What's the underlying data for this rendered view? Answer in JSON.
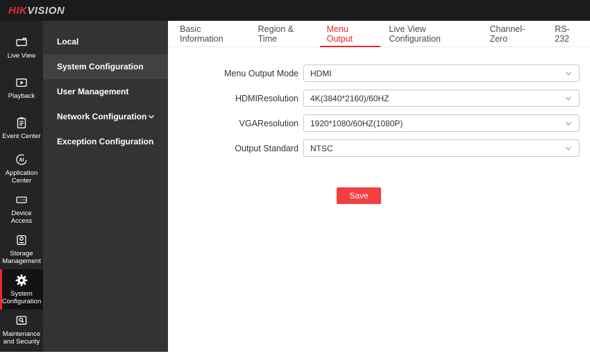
{
  "topbar": {
    "logo_hik": "HIK",
    "logo_vision": "VISION"
  },
  "sidebar": {
    "items": [
      {
        "label": "Live View",
        "icon": "live-view-icon",
        "active": false
      },
      {
        "label": "Playback",
        "icon": "playback-icon",
        "active": false
      },
      {
        "label": "Event Center",
        "icon": "event-center-icon",
        "active": false
      },
      {
        "label": "Application Center",
        "icon": "application-center-icon",
        "active": false
      },
      {
        "label": "Device Access",
        "icon": "device-access-icon",
        "active": false
      },
      {
        "label": "Storage Management",
        "icon": "storage-management-icon",
        "active": false
      },
      {
        "label": "System Configuration",
        "icon": "gear-icon",
        "active": true
      },
      {
        "label": "Maintenance and Security",
        "icon": "maintenance-security-icon",
        "active": false
      }
    ]
  },
  "submenu": {
    "items": [
      {
        "label": "Local",
        "active": false
      },
      {
        "label": "System Configuration",
        "active": true
      },
      {
        "label": "User Management",
        "active": false
      },
      {
        "label": "Network Configuration",
        "active": false,
        "expandable": true
      },
      {
        "label": "Exception Configuration",
        "active": false
      }
    ]
  },
  "tabs": [
    {
      "label": "Basic Information",
      "active": false
    },
    {
      "label": "Region & Time",
      "active": false
    },
    {
      "label": "Menu Output",
      "active": true
    },
    {
      "label": "Live View Configuration",
      "active": false
    },
    {
      "label": "Channel-Zero",
      "active": false
    },
    {
      "label": "RS-232",
      "active": false
    }
  ],
  "form": {
    "fields": [
      {
        "label": "Menu Output Mode",
        "value": "HDMI"
      },
      {
        "label": "HDMIResolution",
        "value": "4K(3840*2160)/60HZ"
      },
      {
        "label": "VGAResolution",
        "value": "1920*1080/60HZ(1080P)"
      },
      {
        "label": "Output Standard",
        "value": "NTSC"
      }
    ],
    "save_label": "Save"
  },
  "colors": {
    "accent_red": "#f0262d",
    "save_button_red": "#f53e43",
    "logo_red": "#e02b31",
    "topbar_bg": "#1b1b1e",
    "sidebar_bg": "#242427",
    "sidebar_active_bg": "#131315",
    "submenu_bg": "#333336",
    "submenu_active_bg": "#414144"
  }
}
